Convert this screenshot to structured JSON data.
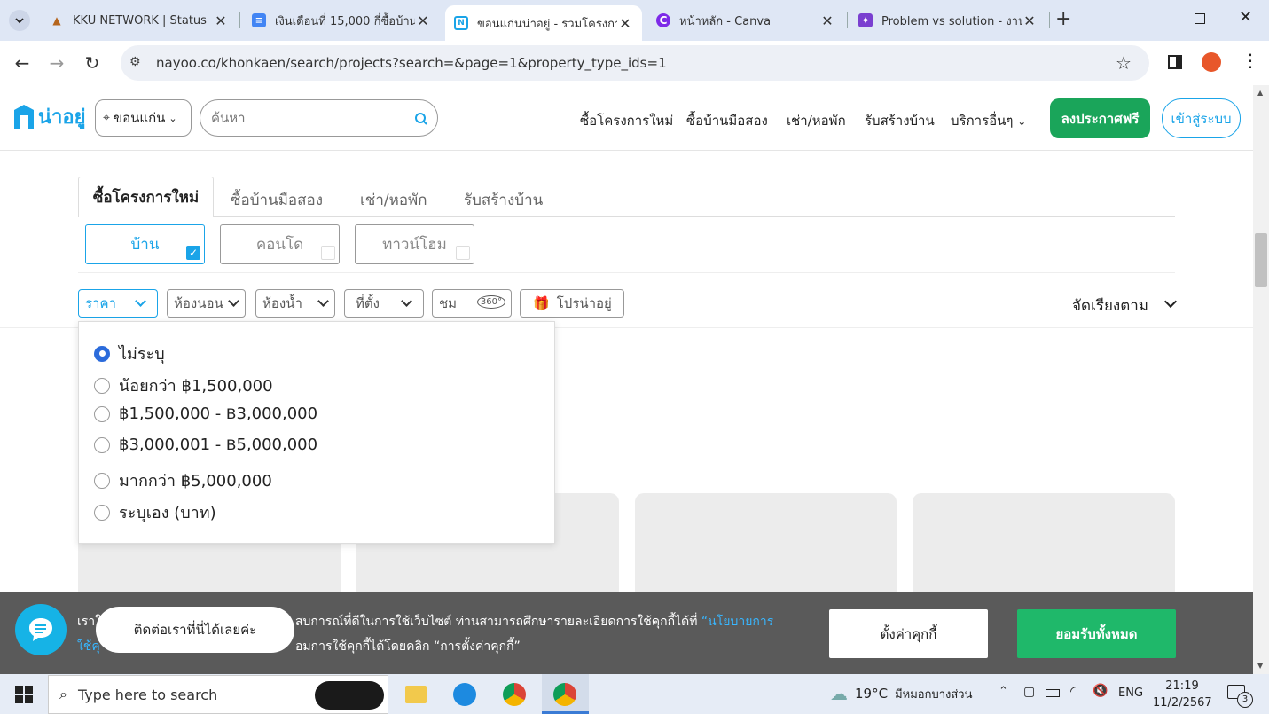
{
  "browser": {
    "tabs": [
      {
        "title": "KKU NETWORK | Status",
        "active": false
      },
      {
        "title": "เงินเดือนที่ 15,000 กี่ซื้อบ้านไ",
        "active": false
      },
      {
        "title": "ขอนแก่นน่าอยู่ - รวมโครงการ",
        "active": true
      },
      {
        "title": "หน้าหลัก - Canva",
        "active": false
      },
      {
        "title": "Problem vs solution - งาน",
        "active": false
      }
    ],
    "url": "nayoo.co/khonkaen/search/projects?search=&page=1&property_type_ids=1"
  },
  "header": {
    "logo_text": "น่าอยู่",
    "location": "ขอนแก่น",
    "search_placeholder": "ค้นหา",
    "nav": [
      "ซื้อโครงการใหม่",
      "ซื้อบ้านมือสอง",
      "เช่า/หอพัก",
      "รับสร้างบ้าน",
      "บริการอื่นๆ"
    ],
    "post_free": "ลงประกาศฟรี",
    "login": "เข้าสู่ระบบ",
    "brand_color": "#1aa4e8",
    "green": "#1aa55a"
  },
  "main": {
    "tabs": [
      "ซื้อโครงการใหม่",
      "ซื้อบ้านมือสอง",
      "เช่า/หอพัก",
      "รับสร้างบ้าน"
    ],
    "active_tab": 0,
    "property_types": [
      {
        "label": "บ้าน",
        "checked": true
      },
      {
        "label": "คอนโด",
        "checked": false
      },
      {
        "label": "ทาวน์โฮม",
        "checked": false
      }
    ],
    "filters": {
      "price": "ราคา",
      "bedroom": "ห้องนอน",
      "bathroom": "ห้องน้ำ",
      "location": "ที่ตั้ง",
      "view": "ชม",
      "view_badge": "360°",
      "promo": "โปรน่าอยู่"
    },
    "sort": "จัดเรียงตาม"
  },
  "price_menu": {
    "options": [
      {
        "label": "ไม่ระบุ",
        "selected": true
      },
      {
        "label": "น้อยกว่า ฿1,500,000",
        "selected": false
      },
      {
        "label": "฿1,500,000 - ฿3,000,000",
        "selected": false
      },
      {
        "label": "฿3,000,001 - ฿5,000,000",
        "selected": false
      },
      {
        "label": "มากกว่า ฿5,000,000",
        "selected": false
      },
      {
        "label": "ระบุเอง (บาท)",
        "selected": false
      }
    ]
  },
  "cookie": {
    "line1_start": "เราใ",
    "line1_mid": "สบการณ์ที่ดีในการใช้เว็บไซต์ ท่านสามารถศึกษารายละเอียดการใช้คุกกี้ได้ที่",
    "line1_link": "“นโยบายการ",
    "line2_start": "ใช้คุ",
    "line2_mid": "อมการใช้คุกกี้ได้โดยคลิก “การตั้งค่าคุกกี้”",
    "settings": "ตั้งค่าคุกกี้",
    "accept": "ยอมรับทั้งหมด",
    "chat_tooltip": "ติดต่อเราที่นี่ได้เลยค่ะ"
  },
  "taskbar": {
    "search_placeholder": "Type here to search",
    "weather": "19°C",
    "weather_text": "มีหมอกบางส่วน",
    "lang": "ENG",
    "time": "21:19",
    "date": "11/2/2567",
    "notif_count": "3"
  }
}
